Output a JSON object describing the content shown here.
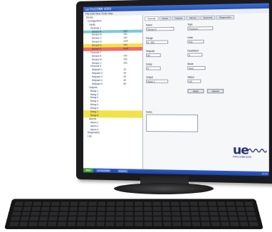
{
  "window": {
    "title": "ue ProCONN 4000",
    "menu": "File  Edit  View  Tools  Help"
  },
  "tree_rows": [
    {
      "label": "Device",
      "indent": 2,
      "value": "",
      "hl": ""
    },
    {
      "label": "Configuration",
      "indent": 4,
      "value": "",
      "hl": ""
    },
    {
      "label": "Inputs",
      "indent": 6,
      "value": "",
      "hl": ""
    },
    {
      "label": "Channel 1",
      "indent": 8,
      "value": "",
      "hl": ""
    },
    {
      "label": "Sensor A",
      "indent": 10,
      "value": "ON",
      "hl": "#7ecad6"
    },
    {
      "label": "Sensor B",
      "indent": 10,
      "value": "ON",
      "hl": ""
    },
    {
      "label": "Sensor C",
      "indent": 10,
      "value": "ON",
      "hl": ""
    },
    {
      "label": "Sensor D",
      "indent": 10,
      "value": "OFF",
      "hl": ""
    },
    {
      "label": "Sensor E",
      "indent": 10,
      "value": "ON",
      "hl": "#f2e24a"
    },
    {
      "label": "Sensor F",
      "indent": 10,
      "value": "ALM",
      "hl": "#f26a6a"
    },
    {
      "label": "Channel 2",
      "indent": 8,
      "value": "",
      "hl": ""
    },
    {
      "label": "Sensor A",
      "indent": 10,
      "value": "ON",
      "hl": ""
    },
    {
      "label": "Sensor B",
      "indent": 10,
      "value": "ON",
      "hl": ""
    },
    {
      "label": "Sensor C",
      "indent": 10,
      "value": "ON",
      "hl": ""
    },
    {
      "label": "Channel 3",
      "indent": 8,
      "value": "",
      "hl": ""
    },
    {
      "label": "Setpoint 1",
      "indent": 10,
      "value": "10",
      "hl": ""
    },
    {
      "label": "Setpoint 2",
      "indent": 10,
      "value": "20",
      "hl": ""
    },
    {
      "label": "Setpoint 3",
      "indent": 10,
      "value": "30",
      "hl": ""
    },
    {
      "label": "Setpoint 4",
      "indent": 10,
      "value": "40",
      "hl": ""
    },
    {
      "label": "Setpoint 5",
      "indent": 10,
      "value": "50",
      "hl": ""
    },
    {
      "label": "Outputs",
      "indent": 6,
      "value": "",
      "hl": ""
    },
    {
      "label": "Relay 1",
      "indent": 8,
      "value": "",
      "hl": ""
    },
    {
      "label": "Relay 2",
      "indent": 8,
      "value": "",
      "hl": ""
    },
    {
      "label": "Relay 3",
      "indent": 8,
      "value": "",
      "hl": ""
    },
    {
      "label": "Relay 4",
      "indent": 8,
      "value": "",
      "hl": ""
    },
    {
      "label": "Relay 5",
      "indent": 8,
      "value": "",
      "hl": ""
    },
    {
      "label": "Relay 6",
      "indent": 8,
      "value": "",
      "hl": ""
    },
    {
      "label": "Relay 7",
      "indent": 8,
      "value": "",
      "hl": "#f2e24a"
    },
    {
      "label": "Relay 8",
      "indent": 8,
      "value": "",
      "hl": "#f2e24a"
    },
    {
      "label": "Alarms",
      "indent": 6,
      "value": "",
      "hl": ""
    },
    {
      "label": "Alarm 1",
      "indent": 8,
      "value": "",
      "hl": ""
    },
    {
      "label": "Alarm 2",
      "indent": 8,
      "value": "",
      "hl": ""
    },
    {
      "label": "Alarm 3",
      "indent": 8,
      "value": "",
      "hl": ""
    },
    {
      "label": "Diagnostics",
      "indent": 4,
      "value": "",
      "hl": ""
    },
    {
      "label": "Log",
      "indent": 4,
      "value": "",
      "hl": ""
    }
  ],
  "tabs": [
    "General",
    "Inputs",
    "Outputs",
    "Alarms",
    "Setpoints",
    "Diagnostics"
  ],
  "active_tab": 0,
  "form": {
    "name_label": "Name",
    "name_value": "Sensor A",
    "type_label": "Type",
    "type_value": "Pressure",
    "range_label": "Range",
    "range_value": "0 - 100",
    "units_label": "Units",
    "units_value": "PSI",
    "setpoint_label": "Setpoint",
    "setpoint_value": "50",
    "deadband_label": "Deadband",
    "deadband_value": "2",
    "delay_label": "Delay",
    "delay_value": "5",
    "mode_label": "Mode",
    "mode_value": "Auto",
    "output_label": "Output",
    "output_value": "Relay 1",
    "status_label": "Status",
    "status_value": "OK",
    "apply_label": "Apply",
    "cancel_label": "Cancel",
    "notes_label": "Notes",
    "notes_value": ""
  },
  "logo": {
    "mark": "ue",
    "sub": "PROCONN 4000"
  },
  "taskbar": {
    "start": "start",
    "item1": "ue ProCONN",
    "item2": "Explorer",
    "clock": "12:00"
  },
  "colors": {
    "title_bar": "#2650b3",
    "taskbar": "#1d43a5",
    "logo": "#26306b"
  }
}
